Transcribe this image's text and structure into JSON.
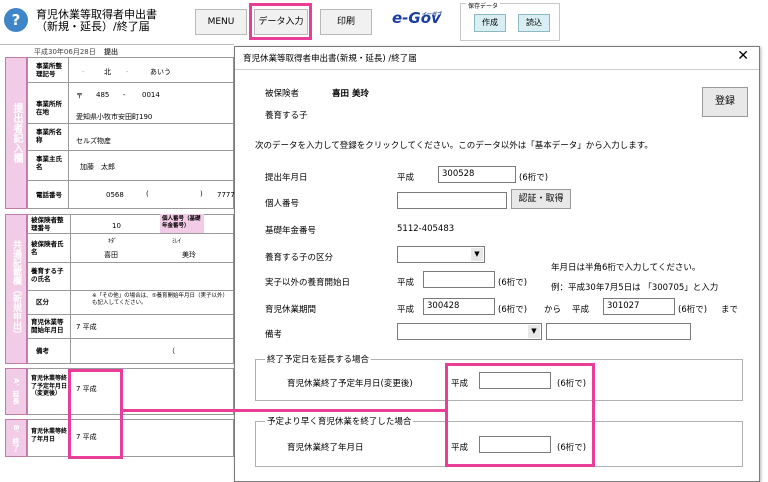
{
  "app": {
    "help_icon": "?",
    "title_line1": "育児休業等取得者申出書",
    "title_line2": "（新規・延長）/終了届"
  },
  "toolbar": {
    "menu": "MENU",
    "data_entry": "データ入力",
    "print": "印刷",
    "egov": "e-Gov",
    "egov_small": "イーガブ",
    "save_group": "保存データ",
    "create": "作成",
    "read": "読込"
  },
  "form": {
    "date_header": "平成30年06月28日",
    "submit": "提出",
    "side_submitter": "提出者記入欄",
    "side_common": "共通記載欄（新規申出）",
    "side_a": "A．延長",
    "side_b": "B．終了",
    "office_code_label": "事業所整理記号",
    "office_code_kita": "北",
    "office_code_au": "あいう",
    "office_addr_label": "事業所所在地",
    "postal_mark": "〒",
    "postal1": "485",
    "postal2": "0014",
    "address": "愛知県小牧市安田町190",
    "office_name_label": "事業所名称",
    "office_name": "セルズ物産",
    "owner_label": "事業主氏名",
    "owner_name": "加藤　太郎",
    "phone_label": "電話番号",
    "phone1": "0568",
    "phone_paren_open": "(",
    "phone2": ")",
    "phone3": "7777",
    "insured_no_label": "被保険者整理番号",
    "insured_no": "10",
    "personal_no_label": "個人番号（基礎年金番号）",
    "insured_name_label": "被保険者氏名",
    "kana_last": "ｷﾀﾞ",
    "kana_first": "ﾐﾚｲ",
    "name_last": "喜田",
    "name_first": "美玲",
    "child_name_label": "養育する子の氏名",
    "kubun_label": "区分",
    "kubun_note": "※「その他」の場合は、⑤養育開始年月日（実子以外）も記入してください。",
    "start_date_label": "育児休業等開始年月日",
    "start_date_val": "7 平成",
    "remarks_label": "備考",
    "remarks_paren": "（",
    "ext_label": "育児休業等終了予定年月日（変更後）",
    "ext_val": "7 平成",
    "end_label": "育児休業等終了年月日",
    "end_val": "7 平成"
  },
  "dialog": {
    "title": "育児休業等取得者申出書(新規・延長) /終了届",
    "close_icon": "✕",
    "insured_label": "被保険者",
    "insured_name": "喜田 美玲",
    "child_label": "養育する子",
    "register": "登録",
    "instruction": "次のデータを入力して登録をクリックしてください。このデータ以外は「基本データ」から入力します。",
    "submit_date_label": "提出年月日",
    "era": "平成",
    "submit_date": "300528",
    "six_digits": "(6桁で)",
    "personal_no_label": "個人番号",
    "personal_no": "",
    "auth_button": "認証・取得",
    "pension_label": "基礎年金番号",
    "pension_no": "5112-405483",
    "child_kubun_label": "養育する子の区分",
    "child_kubun_value": "",
    "adopt_start_label": "実子以外の養育開始日",
    "adopt_start": "",
    "hint1": "年月日は半角6桁で入力してください。",
    "hint2": "例：平成30年7月5日は 「300705」と入力",
    "leave_period_label": "育児休業期間",
    "leave_from": "300428",
    "from_word": "から",
    "leave_to": "301027",
    "until_word": "まで",
    "remarks_label": "備考",
    "remarks_value": "",
    "remarks_text": "",
    "group1_title": "終了予定日を延長する場合",
    "group1_label": "育児休業終了予定年月日(変更後)",
    "group1_value": "",
    "group2_title": "予定より早く育児休業を終了した場合",
    "group2_label": "育児休業終了年月日",
    "group2_value": ""
  },
  "colors": {
    "highlight": "#e83e9a",
    "side_pink": "#f2cbe6",
    "help_blue": "#3f86c8"
  }
}
